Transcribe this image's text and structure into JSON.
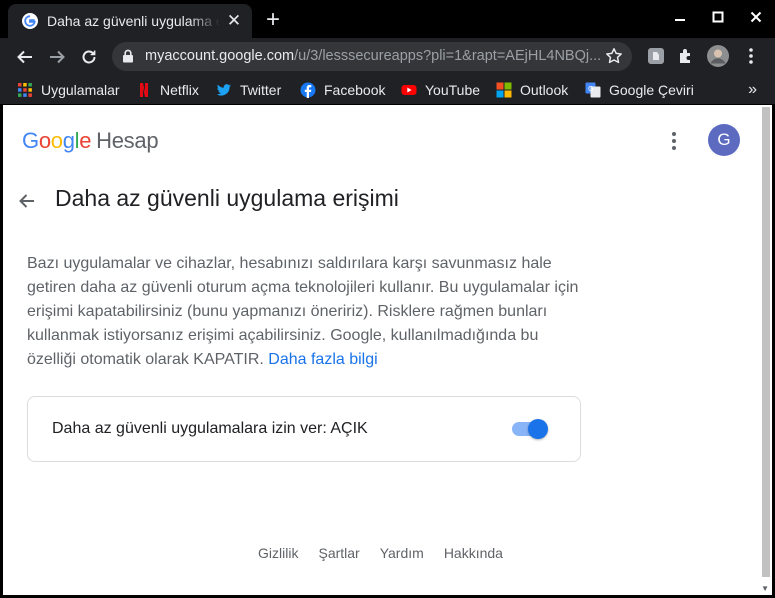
{
  "browser": {
    "tab": {
      "title": "Daha az güvenli uygulama erişimi",
      "close": "✕",
      "favicon": "google-g-icon"
    },
    "new_tab": "+",
    "window_controls": [
      "minimize-icon",
      "maximize-icon",
      "close-icon"
    ],
    "url": {
      "host": "myaccount.google.com",
      "path": "/u/3/lesssecureapps?pli=1&rapt=AEjHL4NBQj..."
    },
    "bookmarks": [
      {
        "label": "Uygulamalar",
        "icon": "apps-grid-icon"
      },
      {
        "label": "Netflix",
        "icon": "netflix-icon"
      },
      {
        "label": "Twitter",
        "icon": "twitter-icon"
      },
      {
        "label": "Facebook",
        "icon": "facebook-icon"
      },
      {
        "label": "YouTube",
        "icon": "youtube-icon"
      },
      {
        "label": "Outlook",
        "icon": "outlook-icon"
      },
      {
        "label": "Google Çeviri",
        "icon": "google-translate-icon"
      }
    ],
    "bookmarks_more": "»"
  },
  "header": {
    "logo_letters": [
      "G",
      "o",
      "o",
      "g",
      "l",
      "e"
    ],
    "product": "Hesap",
    "avatar_initial": "G"
  },
  "main": {
    "title": "Daha az güvenli uygulama erişimi",
    "description": "Bazı uygulamalar ve cihazlar, hesabınızı saldırılara karşı savunmasız hale getiren daha az güvenli oturum açma teknolojileri kullanır. Bu uygulamalar için erişimi kapatabilirsiniz (bunu yapmanızı öneririz). Risklere rağmen bunları kullanmak istiyorsanız erişimi açabilirsiniz. Google, kullanılmadığında bu özelliği otomatik olarak KAPATIR.",
    "learn_more": "Daha fazla bilgi",
    "setting_label": "Daha az güvenli uygulamalara izin ver: AÇIK",
    "setting_on": true
  },
  "footer": {
    "links": [
      "Gizlilik",
      "Şartlar",
      "Yardım",
      "Hakkında"
    ]
  },
  "colors": {
    "accent": "#1a73e8",
    "toggle_track": "#8ab4f8",
    "chrome_bg": "#202124",
    "avatar": "#5c6bc0"
  }
}
